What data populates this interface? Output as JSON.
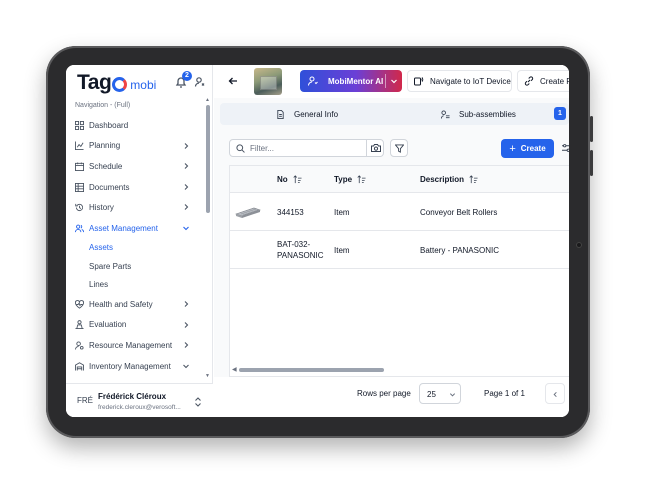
{
  "brand": {
    "name": "Tag",
    "sub": "mobi",
    "notification_count": "2"
  },
  "sidebar": {
    "caption": "Navigation - (Full)",
    "items": [
      {
        "label": "Dashboard"
      },
      {
        "label": "Planning"
      },
      {
        "label": "Schedule"
      },
      {
        "label": "Documents"
      },
      {
        "label": "History"
      },
      {
        "label": "Asset Management"
      },
      {
        "label": "Assets"
      },
      {
        "label": "Spare Parts"
      },
      {
        "label": "Lines"
      },
      {
        "label": "Health and Safety"
      },
      {
        "label": "Evaluation"
      },
      {
        "label": "Resource Management"
      },
      {
        "label": "Inventory Management"
      }
    ],
    "user": {
      "initials": "FRÉ",
      "name": "Frédérick Cléroux",
      "email": "frederick.cleroux@verosoft..."
    }
  },
  "topbar": {
    "ai_label": "MobiMentor AI",
    "iot_label": "Navigate to IoT Device",
    "create_label": "Create Re"
  },
  "tabs": {
    "general": "General Info",
    "subassemblies": "Sub-assemblies",
    "subassemblies_count": "1"
  },
  "toolbar": {
    "filter_placeholder": "Filter...",
    "create_label": "Create"
  },
  "table": {
    "headers": {
      "no": "No",
      "type": "Type",
      "description": "Description"
    },
    "rows": [
      {
        "no": "344153",
        "type": "Item",
        "description": "Conveyor Belt Rollers"
      },
      {
        "no": "BAT-032-PANASONIC",
        "no_line1": "BAT-032-",
        "no_line2": "PANASONIC",
        "type": "Item",
        "description": "Battery - PANASONIC"
      }
    ]
  },
  "footer": {
    "rows_per_page_label": "Rows per page",
    "rows_per_page_value": "25",
    "page_label": "Page 1 of 1"
  }
}
